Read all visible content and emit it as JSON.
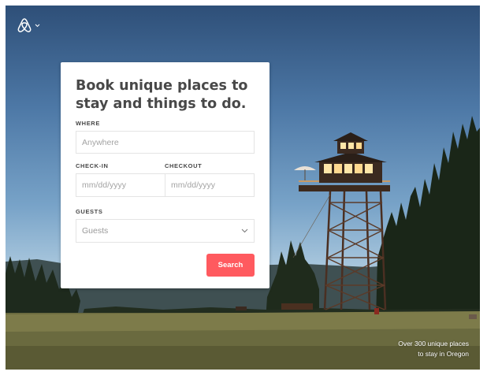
{
  "header": {
    "logo_icon": "airbnb-logo-icon",
    "menu_icon": "chevron-down-icon"
  },
  "search_card": {
    "headline": "Book unique places to stay and things to do.",
    "where": {
      "label": "WHERE",
      "placeholder": "Anywhere"
    },
    "check_in": {
      "label": "CHECK-IN",
      "placeholder": "mm/dd/yyyy"
    },
    "checkout": {
      "label": "CHECKOUT",
      "placeholder": "mm/dd/yyyy"
    },
    "guests": {
      "label": "GUESTS",
      "selected": "Guests",
      "icon": "chevron-down-icon"
    },
    "search_label": "Search"
  },
  "caption": {
    "line1": "Over 300 unique places",
    "line2": "to stay in Oregon"
  },
  "colors": {
    "accent": "#ff5a5f",
    "text": "#484848",
    "border": "#e4e4e4"
  }
}
